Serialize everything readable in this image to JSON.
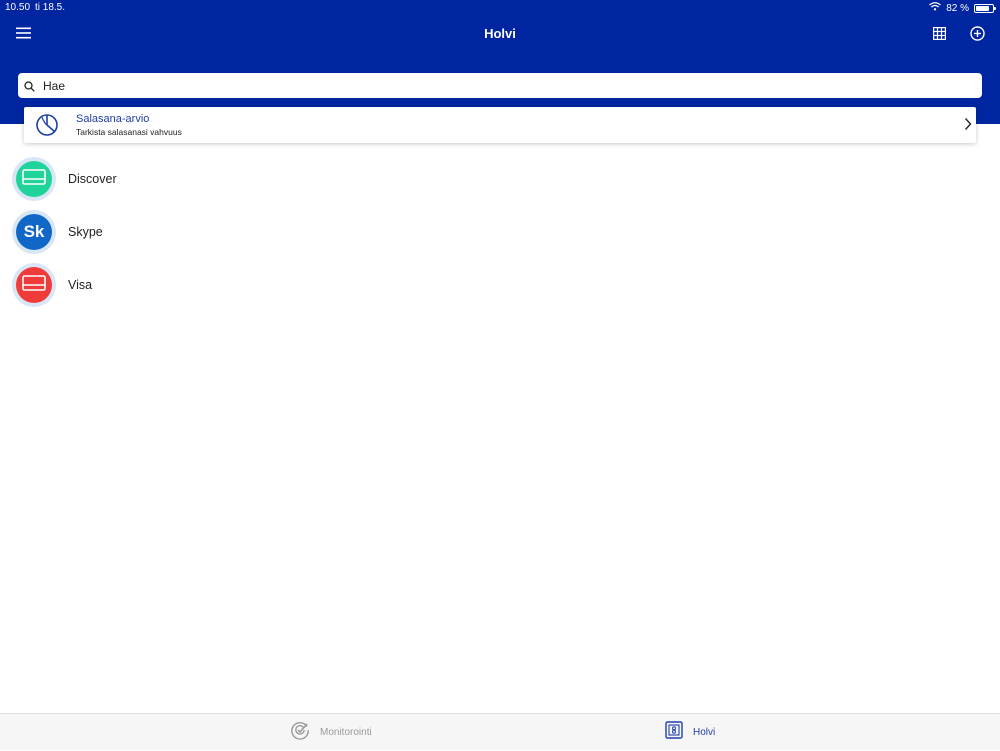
{
  "status_bar": {
    "time": "10.50",
    "date": "ti 18.5.",
    "battery_text": "82 %",
    "battery_level": 0.82
  },
  "nav": {
    "title": "Holvi",
    "menu_icon": "hamburger-menu-icon",
    "grid_icon": "grid-icon",
    "add_icon": "add-circle-icon"
  },
  "search": {
    "placeholder": "Hae",
    "value": ""
  },
  "password_check": {
    "title": "Salasana-arvio",
    "subtitle": "Tarkista salasanasi vahvuus",
    "icon": "gauge-icon"
  },
  "items": [
    {
      "label": "Discover",
      "icon": "card-icon",
      "color": "#1fd39a"
    },
    {
      "label": "Skype",
      "initials": "Sk",
      "color": "#1167c8"
    },
    {
      "label": "Visa",
      "icon": "card-icon",
      "color": "#f03b3b"
    }
  ],
  "tabs": [
    {
      "label": "Monitorointi",
      "icon": "radar-check-icon",
      "active": false
    },
    {
      "label": "Holvi",
      "icon": "vault-icon",
      "active": true
    }
  ],
  "colors": {
    "brand": "#0025a0",
    "accent": "#1f3fa8",
    "tab_inactive": "#9a9a9a"
  }
}
